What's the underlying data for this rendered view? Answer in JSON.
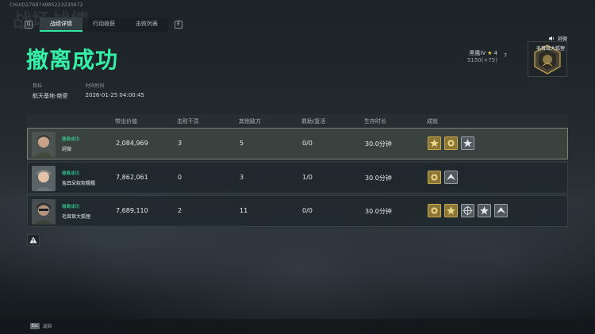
{
  "header": {
    "session_id": "CHUID276974985223230672",
    "ghost_text": "战场战绩"
  },
  "tabs": {
    "key_left": "Q",
    "key_right": "E",
    "items": [
      {
        "label": "战绩详情",
        "active": true
      },
      {
        "label": "行动收获",
        "active": false
      },
      {
        "label": "击败列表",
        "active": false
      }
    ]
  },
  "result": {
    "title": "撤离成功",
    "target_label": "目标",
    "target_value": "航天基地-绝密",
    "time_label": "时间时间",
    "time_value": "2026-01-25 04:00:45"
  },
  "user": {
    "name": "訶微",
    "rank": "黑鹰IV",
    "stars": "4",
    "xp": "5150(+75)",
    "help": "?",
    "emblem_name": "毛茸茸大狐狸"
  },
  "table": {
    "headers": [
      "带出价值",
      "击败干员",
      "其他敌方",
      "救助/复活",
      "生存时长",
      "成就"
    ],
    "rows": [
      {
        "status": "撤离成功",
        "name": "訶微",
        "value": "2,084,969",
        "kills": "3",
        "other": "5",
        "rescue": "0/0",
        "time": "30.0分钟",
        "self": true,
        "badges": [
          "gold-star-badge",
          "gold-sun-badge",
          "silver-star-badge"
        ]
      },
      {
        "status": "撤离成功",
        "name": "兔耳朵软软糯糯",
        "value": "7,862,061",
        "kills": "0",
        "other": "3",
        "rescue": "1/0",
        "time": "30.0分钟",
        "self": false,
        "badges": [
          "gold-sun-badge",
          "silver-wing-badge"
        ]
      },
      {
        "status": "撤离成功",
        "name": "毛茸茸大狐狸",
        "value": "7,689,110",
        "kills": "2",
        "other": "11",
        "rescue": "0/0",
        "time": "30.0分钟",
        "self": false,
        "badges": [
          "gold-sun-badge",
          "gold-star-badge",
          "silver-target-badge",
          "silver-star-badge",
          "silver-wing-badge"
        ]
      }
    ]
  },
  "footer": {
    "esc_key": "Esc",
    "esc_label": "返回"
  },
  "colors": {
    "accent": "#35f0a6",
    "gold": "#c9a94e",
    "silver": "#9aa3a8"
  }
}
